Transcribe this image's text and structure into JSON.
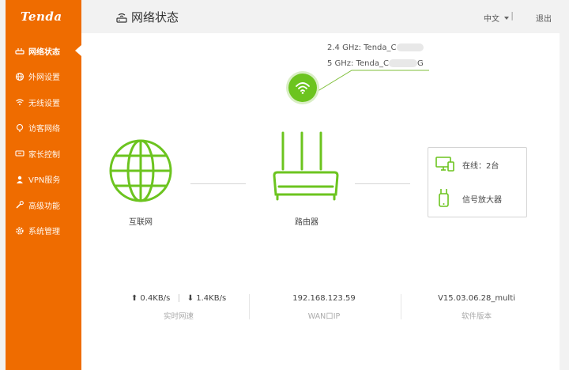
{
  "brand": {
    "logo_text": "Tenda",
    "accent": "#ef6c00",
    "green": "#6cc41f"
  },
  "sidebar": {
    "items": [
      {
        "label": "网络状态",
        "icon": "status-icon",
        "active": true
      },
      {
        "label": "外网设置",
        "icon": "globe-icon",
        "active": false
      },
      {
        "label": "无线设置",
        "icon": "wifi-icon",
        "active": false
      },
      {
        "label": "访客网络",
        "icon": "guest-icon",
        "active": false
      },
      {
        "label": "家长控制",
        "icon": "parental-control-icon",
        "active": false
      },
      {
        "label": "VPN服务",
        "icon": "vpn-icon",
        "active": false
      },
      {
        "label": "高级功能",
        "icon": "tools-icon",
        "active": false
      },
      {
        "label": "系统管理",
        "icon": "gear-icon",
        "active": false
      }
    ]
  },
  "header": {
    "title": "网络状态",
    "language": "中文",
    "separator": "|",
    "logout": "退出"
  },
  "wifi": {
    "ssid_24_prefix": "2.4 GHz: Tenda_C",
    "ssid_5_prefix": "5 GHz: Tenda_C",
    "ssid_5_suffix": "G"
  },
  "topology": {
    "internet_label": "互联网",
    "router_label": "路由器",
    "online_label": "在线：2台",
    "extender_label": "信号放大器"
  },
  "stats": {
    "upload": "0.4KB/s",
    "download": "1.4KB/s",
    "speed_label": "实时网速",
    "wan_ip": "192.168.123.59",
    "wan_ip_label": "WAN口IP",
    "firmware": "V15.03.06.28_multi",
    "firmware_label": "软件版本"
  }
}
